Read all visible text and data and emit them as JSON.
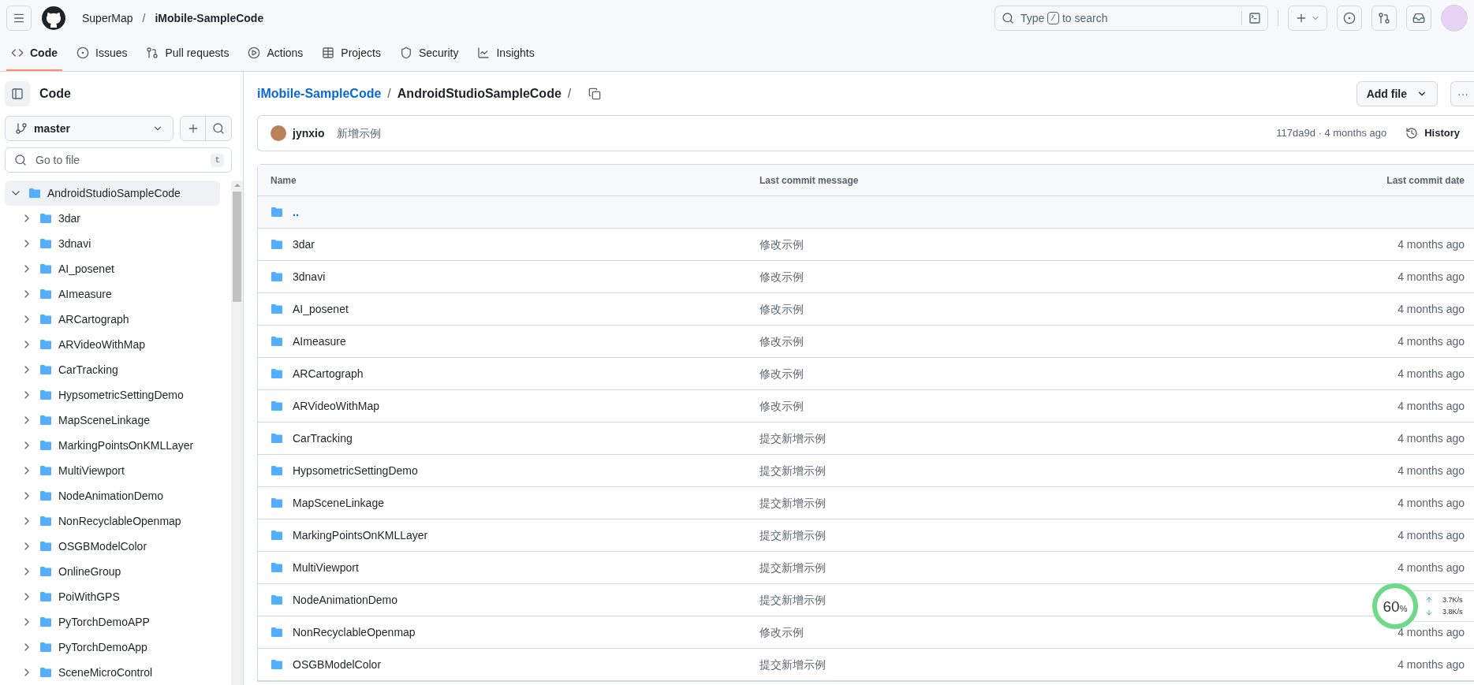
{
  "header": {
    "owner": "SuperMap",
    "separator": "/",
    "repo": "iMobile-SampleCode",
    "search": {
      "before": "Type",
      "key": "/",
      "after": "to search"
    }
  },
  "tabs": [
    {
      "label": "Code",
      "selected": true
    },
    {
      "label": "Issues",
      "selected": false
    },
    {
      "label": "Pull requests",
      "selected": false
    },
    {
      "label": "Actions",
      "selected": false
    },
    {
      "label": "Projects",
      "selected": false
    },
    {
      "label": "Security",
      "selected": false
    },
    {
      "label": "Insights",
      "selected": false
    }
  ],
  "sidebar": {
    "title": "Code",
    "branch": "master",
    "file_search": {
      "placeholder": "Go to file",
      "shortcut": "t"
    },
    "tree": [
      {
        "name": "AndroidStudioSampleCode",
        "expanded": true,
        "selected": true,
        "children": [
          {
            "name": "3dar",
            "expanded": false,
            "selected": false
          },
          {
            "name": "3dnavi",
            "expanded": false,
            "selected": false
          },
          {
            "name": "AI_posenet",
            "expanded": false,
            "selected": false
          },
          {
            "name": "AImeasure",
            "expanded": false,
            "selected": false
          },
          {
            "name": "ARCartograph",
            "expanded": false,
            "selected": false
          },
          {
            "name": "ARVideoWithMap",
            "expanded": false,
            "selected": false
          },
          {
            "name": "CarTracking",
            "expanded": false,
            "selected": false
          },
          {
            "name": "HypsometricSettingDemo",
            "expanded": false,
            "selected": false
          },
          {
            "name": "MapSceneLinkage",
            "expanded": false,
            "selected": false
          },
          {
            "name": "MarkingPointsOnKMLLayer",
            "expanded": false,
            "selected": false
          },
          {
            "name": "MultiViewport",
            "expanded": false,
            "selected": false
          },
          {
            "name": "NodeAnimationDemo",
            "expanded": false,
            "selected": false
          },
          {
            "name": "NonRecyclableOpenmap",
            "expanded": false,
            "selected": false
          },
          {
            "name": "OSGBModelColor",
            "expanded": false,
            "selected": false
          },
          {
            "name": "OnlineGroup",
            "expanded": false,
            "selected": false
          },
          {
            "name": "PoiWithGPS",
            "expanded": false,
            "selected": false
          },
          {
            "name": "PyTorchDemoAPP",
            "expanded": false,
            "selected": false
          },
          {
            "name": "PyTorchDemoApp",
            "expanded": false,
            "selected": false
          },
          {
            "name": "SceneMicroControl",
            "expanded": false,
            "selected": false
          }
        ]
      }
    ]
  },
  "breadcrumb": {
    "repo": "iMobile-SampleCode",
    "separator": "/",
    "folder": "AndroidStudioSampleCode",
    "trailing": "/"
  },
  "actions": {
    "add_file": "Add file",
    "more": "···"
  },
  "latest_commit": {
    "author": "jynxio",
    "message": "新增示例",
    "hash": "117da9d · 4 months ago",
    "history": "History"
  },
  "table": {
    "columns": [
      "Name",
      "Last commit message",
      "Last commit date"
    ],
    "parent": "..",
    "rows": [
      {
        "name": "3dar",
        "message": "修改示例",
        "date": "4 months ago"
      },
      {
        "name": "3dnavi",
        "message": "修改示例",
        "date": "4 months ago"
      },
      {
        "name": "AI_posenet",
        "message": "修改示例",
        "date": "4 months ago"
      },
      {
        "name": "AImeasure",
        "message": "修改示例",
        "date": "4 months ago"
      },
      {
        "name": "ARCartograph",
        "message": "修改示例",
        "date": "4 months ago"
      },
      {
        "name": "ARVideoWithMap",
        "message": "修改示例",
        "date": "4 months ago"
      },
      {
        "name": "CarTracking",
        "message": "提交新增示例",
        "date": "4 months ago"
      },
      {
        "name": "HypsometricSettingDemo",
        "message": "提交新增示例",
        "date": "4 months ago"
      },
      {
        "name": "MapSceneLinkage",
        "message": "提交新增示例",
        "date": "4 months ago"
      },
      {
        "name": "MarkingPointsOnKMLLayer",
        "message": "提交新增示例",
        "date": "4 months ago"
      },
      {
        "name": "MultiViewport",
        "message": "提交新增示例",
        "date": "4 months ago"
      },
      {
        "name": "NodeAnimationDemo",
        "message": "提交新增示例"
      },
      {
        "name": "NonRecyclableOpenmap",
        "message": "修改示例",
        "date": "4 months ago"
      },
      {
        "name": "OSGBModelColor",
        "message": "提交新增示例",
        "date": "4 months ago"
      }
    ]
  },
  "speed_widget": {
    "percent": "60",
    "unit": "%",
    "up": "3.7K/s",
    "down": "3.8K/s"
  }
}
